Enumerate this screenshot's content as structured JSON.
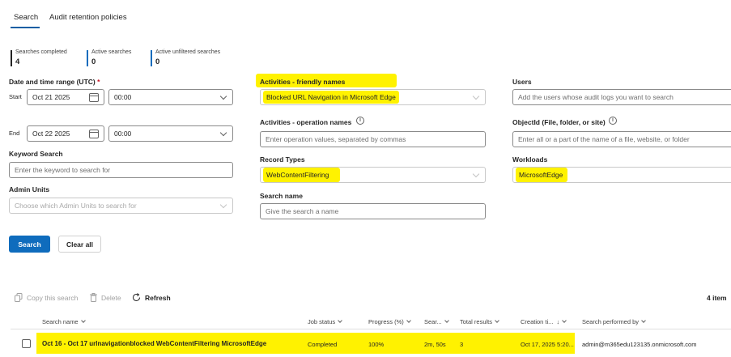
{
  "tabs": [
    {
      "label": "Search"
    },
    {
      "label": "Audit retention policies"
    }
  ],
  "stats": [
    {
      "label": "Searches completed",
      "value": "4",
      "color": "#242424"
    },
    {
      "label": "Active searches",
      "value": "0",
      "color": "#0f6cbd"
    },
    {
      "label": "Active unfiltered searches",
      "value": "0",
      "color": "#0f6cbd"
    }
  ],
  "date_range": {
    "label": "Date and time range (UTC)",
    "required_mark": "*",
    "start_label": "Start",
    "start_date": "Oct 21 2025",
    "start_time": "00:00",
    "end_label": "End",
    "end_date": "Oct 22 2025",
    "end_time": "00:00"
  },
  "keyword": {
    "label": "Keyword Search",
    "placeholder": "Enter the keyword to search for"
  },
  "admin_units": {
    "label": "Admin Units",
    "placeholder": "Choose which Admin Units to search for"
  },
  "activities_friendly": {
    "label": "Activities - friendly names",
    "value": "Blocked URL Navigation in Microsoft Edge"
  },
  "activities_operation": {
    "label": "Activities - operation names",
    "placeholder": "Enter operation values, separated by commas"
  },
  "record_types": {
    "label": "Record Types",
    "value": "WebContentFiltering"
  },
  "search_name": {
    "label": "Search name",
    "placeholder": "Give the search a name"
  },
  "users": {
    "label": "Users",
    "placeholder": "Add the users whose audit logs you want to search"
  },
  "object_id": {
    "label": "ObjectId (File, folder, or site)",
    "placeholder": "Enter all or a part of the name of a file, website, or folder"
  },
  "workloads": {
    "label": "Workloads",
    "value": "MicrosoftEdge"
  },
  "buttons": {
    "search": "Search",
    "clear_all": "Clear all"
  },
  "toolbar": {
    "copy": "Copy this search",
    "delete": "Delete",
    "refresh": "Refresh",
    "item_count": "4 item"
  },
  "table": {
    "columns": [
      "Search name",
      "Job status",
      "Progress (%)",
      "Sear...",
      "Total results",
      "Creation ti...",
      "Search performed by"
    ],
    "rows": [
      {
        "name": "Oct 16 - Oct 17 urlnavigationblocked WebContentFiltering MicrosoftEdge",
        "status": "Completed",
        "progress": "100%",
        "search_time": "2m, 50s",
        "total_results": "3",
        "creation_time": "Oct 17, 2025 5:20...",
        "performed_by": "admin@m365edu123135.onmicrosoft.com"
      }
    ]
  },
  "colors": {
    "accent": "#0f6cbd",
    "highlight": "#fff200",
    "required": "#c50f1f"
  }
}
